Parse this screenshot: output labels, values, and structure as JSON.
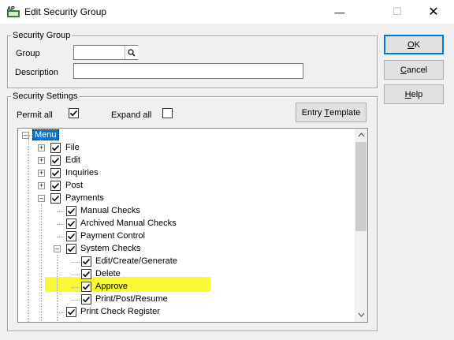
{
  "window": {
    "title": "Edit Security Group",
    "app_icon_text": "AP"
  },
  "security_group": {
    "legend": "Security Group",
    "group_label": "Group",
    "group_value": "",
    "description_label": "Description",
    "description_value": ""
  },
  "buttons": {
    "ok_underline": "O",
    "ok_rest": "K",
    "cancel_underline": "C",
    "cancel_rest": "ancel",
    "help_underline": "H",
    "help_rest": "elp"
  },
  "security_settings": {
    "legend": "Security Settings",
    "permit_all_label": "Permit all",
    "expand_all_label": "Expand all",
    "entry_template_prefix": "Entry ",
    "entry_template_underline": "T",
    "entry_template_rest": "emplate"
  },
  "tree": {
    "root": "Menu",
    "items": [
      {
        "label": "File"
      },
      {
        "label": "Edit"
      },
      {
        "label": "Inquiries"
      },
      {
        "label": "Post"
      },
      {
        "label": "Payments"
      },
      {
        "label": "Manual Checks"
      },
      {
        "label": "Archived Manual Checks"
      },
      {
        "label": "Payment Control"
      },
      {
        "label": "System Checks"
      },
      {
        "label": "Edit/Create/Generate"
      },
      {
        "label": "Delete"
      },
      {
        "label": "Approve"
      },
      {
        "label": "Print/Post/Resume"
      },
      {
        "label": "Print Check Register"
      }
    ]
  },
  "colors": {
    "highlight": "#f7f71f",
    "selection": "#0078d7"
  }
}
